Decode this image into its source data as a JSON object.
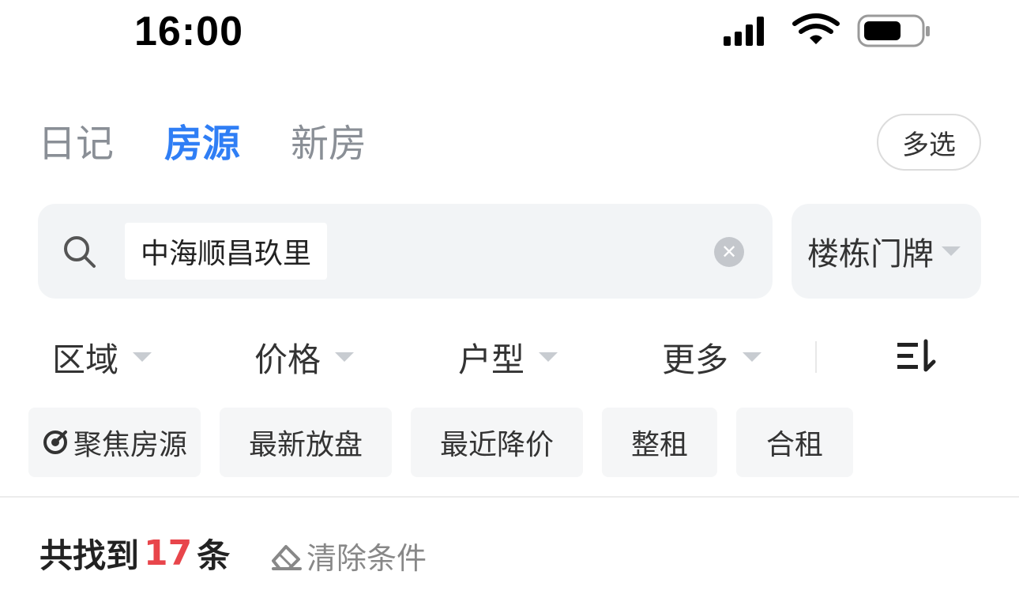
{
  "status_bar": {
    "time": "16:00",
    "icons": [
      "signal-icon",
      "wifi-icon",
      "battery-icon"
    ]
  },
  "tabs": [
    {
      "label": "日记",
      "active": false
    },
    {
      "label": "房源",
      "active": true
    },
    {
      "label": "新房",
      "active": false
    }
  ],
  "multi_select_label": "多选",
  "search": {
    "keyword": "中海顺昌玖里",
    "icon": "search-icon",
    "clear_icon": "clear-icon"
  },
  "building_selector": {
    "label": "楼栋门牌"
  },
  "filters": [
    {
      "label": "区域"
    },
    {
      "label": "价格"
    },
    {
      "label": "户型"
    },
    {
      "label": "更多"
    }
  ],
  "sort_icon": "sort-icon",
  "chips": [
    {
      "label": "聚焦房源",
      "icon": "focus-target-icon"
    },
    {
      "label": "最新放盘"
    },
    {
      "label": "最近降价"
    },
    {
      "label": "整租"
    },
    {
      "label": "合租"
    }
  ],
  "result": {
    "prefix": "共找到",
    "count": "17",
    "suffix": "条",
    "clear_label": "清除条件",
    "clear_icon": "eraser-icon"
  },
  "colors": {
    "accent": "#2f7ef5",
    "count": "#e8454b",
    "muted": "#8a8f96",
    "surface": "#f2f4f6"
  }
}
